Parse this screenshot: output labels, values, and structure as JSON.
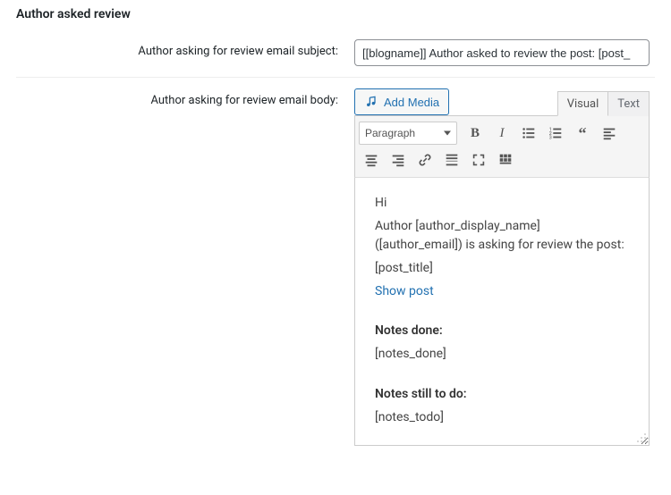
{
  "section": {
    "heading": "Author asked review"
  },
  "subject": {
    "label": "Author asking for review email subject:",
    "value": "[[blogname]] Author asked to review the post: [post_"
  },
  "body": {
    "label": "Author asking for review email body:",
    "add_media": "Add Media",
    "tabs": {
      "visual": "Visual",
      "text": "Text"
    },
    "format_select": "Paragraph",
    "content": {
      "line1": "Hi",
      "line2": "Author [author_display_name] ([author_email]) is asking for review the post:",
      "line3": "[post_title]",
      "link": "Show post",
      "notes_done_label": "Notes done:",
      "notes_done_value": "[notes_done]",
      "notes_todo_label": "Notes still to do:",
      "notes_todo_value": "[notes_todo]"
    }
  }
}
